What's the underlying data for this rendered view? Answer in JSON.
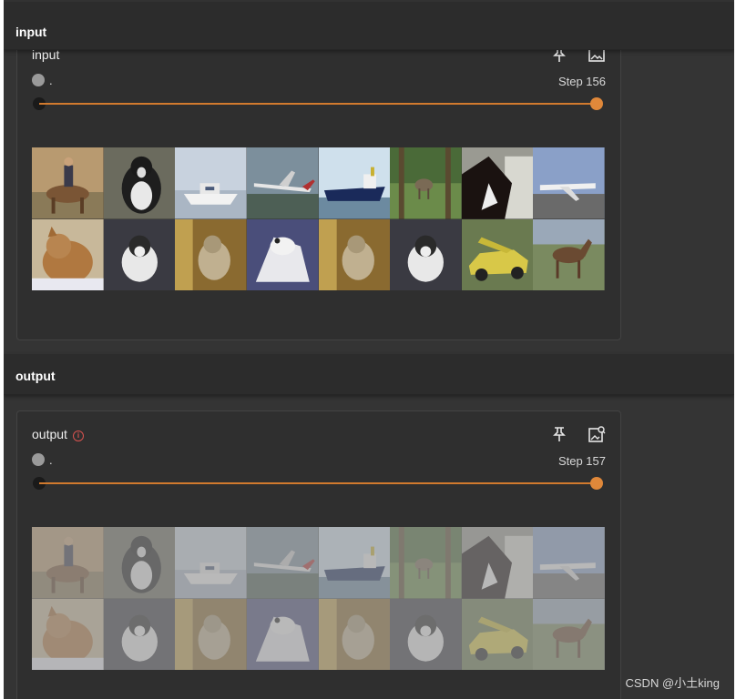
{
  "sections": [
    {
      "header": "input",
      "card": {
        "title": "input",
        "has_info_icon": false,
        "run_label": ".",
        "step_label": "Step 156",
        "pin_icon": "pin-icon",
        "image_icon": "image-fit-icon"
      }
    },
    {
      "header": "output",
      "card": {
        "title": "output",
        "has_info_icon": true,
        "run_label": ".",
        "step_label": "Step 157",
        "pin_icon": "pin-icon",
        "image_icon": "image-search-icon"
      }
    }
  ],
  "image_grid": {
    "columns": 8,
    "rows": 2,
    "tiles": [
      "horse-rider",
      "dog",
      "boat",
      "airplane",
      "ship",
      "deer",
      "horse",
      "airplane",
      "cat",
      "dog",
      "cat",
      "frog",
      "cat",
      "dog",
      "car",
      "horse"
    ]
  },
  "colors": {
    "accent": "#d17a2e",
    "background": "#343434",
    "card": "#2f2f2f",
    "info": "#d9534f"
  },
  "watermark": "CSDN @小土king"
}
